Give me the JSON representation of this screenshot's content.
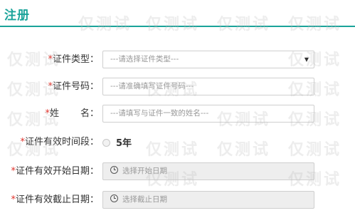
{
  "header": {
    "title": "注册"
  },
  "watermark": {
    "text": "仅测试"
  },
  "form": {
    "required_mark": "*",
    "id_type": {
      "label": "证件类型：",
      "placeholder": "---请选择证件类型---"
    },
    "id_number": {
      "label": "证件号码：",
      "placeholder": "---请准确填写证件号码---"
    },
    "name": {
      "label_first": "姓",
      "label_last": "名：",
      "placeholder": "---请填写与证件一致的姓名---"
    },
    "validity": {
      "label": "证件有效时间段：",
      "option": "5年"
    },
    "start_date": {
      "label": "证件有效开始日期：",
      "placeholder": "选择开始日期"
    },
    "end_date": {
      "label": "证件有效截止日期：",
      "placeholder": "选择截止日期"
    }
  },
  "colors": {
    "accent": "#1aa39a",
    "required": "#e0322b",
    "disabled_bg": "#eeeeee"
  },
  "icons": {
    "select_caret": "chevron-down-icon",
    "date": "clock-icon"
  }
}
